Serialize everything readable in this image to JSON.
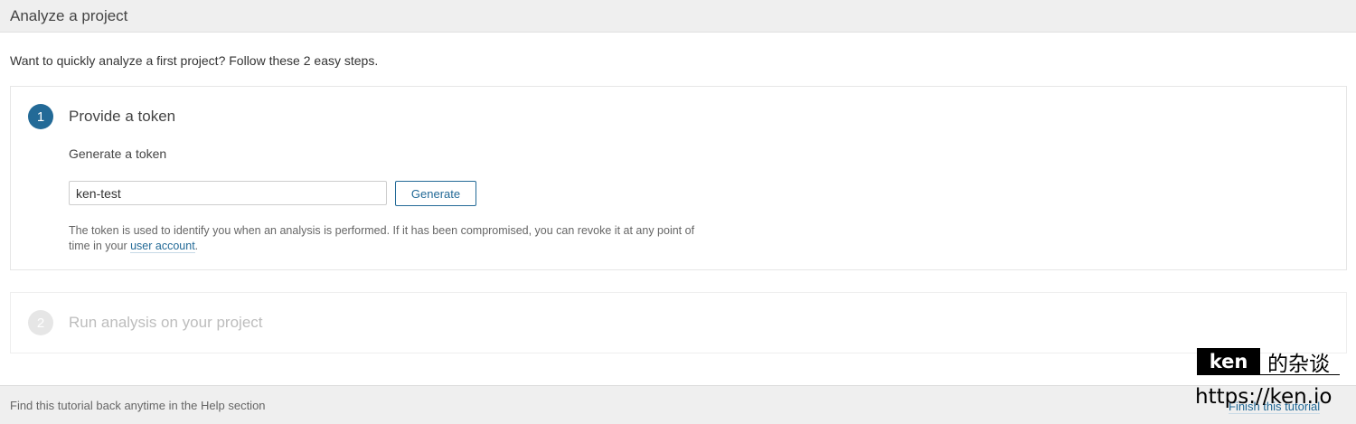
{
  "header": {
    "title": "Analyze a project"
  },
  "intro": "Want to quickly analyze a first project? Follow these 2 easy steps.",
  "steps": [
    {
      "number": "1",
      "title": "Provide a token",
      "subheading": "Generate a token",
      "token_input": {
        "value": "ken-test",
        "placeholder": ""
      },
      "generate_label": "Generate",
      "help_text_before": "The token is used to identify you when an analysis is performed. If it has been compromised, you can revoke it at any point of time in your ",
      "help_link": "user account",
      "help_text_after": "."
    },
    {
      "number": "2",
      "title": "Run analysis on your project"
    }
  ],
  "footer": {
    "text": "Find this tutorial back anytime in the Help section",
    "finish_link": "Finish this tutorial"
  },
  "watermark": {
    "badge": "ken",
    "chinese": "的杂谈",
    "url": "https://ken.io"
  },
  "colors": {
    "accent": "#236a97",
    "header_bg": "#efefef",
    "disabled": "#bdbdbd"
  }
}
